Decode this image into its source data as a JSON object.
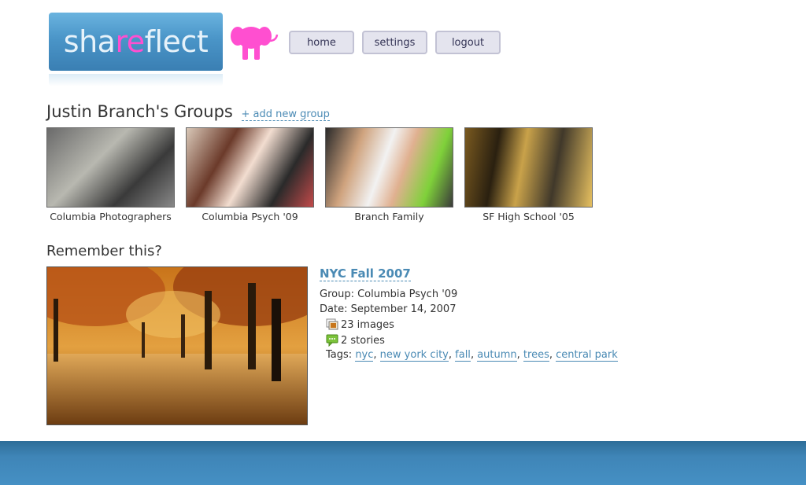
{
  "logo": {
    "part1": "sha",
    "part2": "re",
    "part3": "flect"
  },
  "mascot": {
    "icon": "pink-elephant-icon",
    "color": "#ff4fd0"
  },
  "nav": {
    "home": "home",
    "settings": "settings",
    "logout": "logout"
  },
  "groups": {
    "heading": "Justin Branch's Groups",
    "add_link": "+ add new group",
    "items": [
      {
        "name": "Columbia Photographers"
      },
      {
        "name": "Columbia Psych '09"
      },
      {
        "name": "Branch Family"
      },
      {
        "name": "SF High School '05"
      }
    ]
  },
  "remember": {
    "heading": "Remember this?",
    "title": "NYC Fall 2007",
    "group": "Group: Columbia Psych '09",
    "date": "Date: September 14, 2007",
    "images": "23 images",
    "stories": "2 stories",
    "tags_label": "Tags:",
    "tags": [
      "nyc",
      "new york city",
      "fall",
      "autumn",
      "trees",
      "central park"
    ]
  },
  "colors": {
    "accent": "#4a8ab4",
    "brand": "#4a95c8",
    "footer": "#3f85b7"
  }
}
